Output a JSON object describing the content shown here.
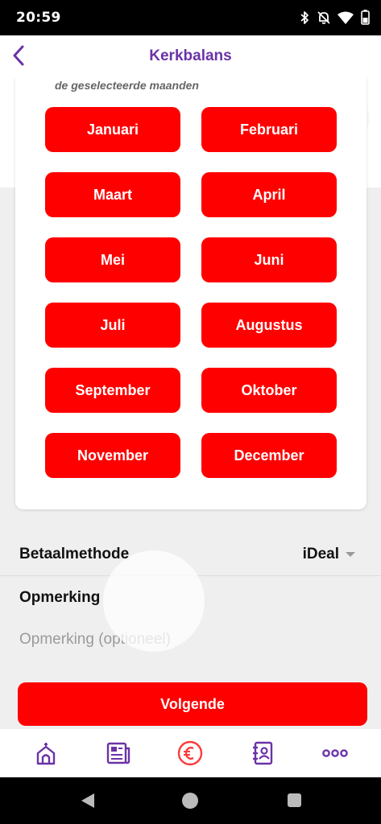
{
  "status_bar": {
    "time": "20:59",
    "icons": [
      "bluetooth-icon",
      "bell-off-icon",
      "wifi-icon",
      "battery-icon"
    ]
  },
  "header": {
    "title": "Kerkbalans",
    "back_icon": "chevron-left-icon"
  },
  "months_section": {
    "subtitle": "de geselecteerde maanden",
    "months": [
      "Januari",
      "Februari",
      "Maart",
      "April",
      "Mei",
      "Juni",
      "Juli",
      "Augustus",
      "September",
      "Oktober",
      "November",
      "December"
    ]
  },
  "payment": {
    "label": "Betaalmethode",
    "value": "iDeal"
  },
  "remark": {
    "label": "Opmerking",
    "placeholder": "Opmerking (optioneel)",
    "value": ""
  },
  "next_button": {
    "label": "Volgende"
  },
  "bottom_nav": {
    "items": [
      "church-home-icon",
      "news-icon",
      "euro-icon",
      "address-book-icon",
      "more-icon"
    ],
    "active_index": 2
  },
  "colors": {
    "accent": "#6b32a8",
    "primary_red": "#ff0000",
    "background": "#efefef"
  }
}
